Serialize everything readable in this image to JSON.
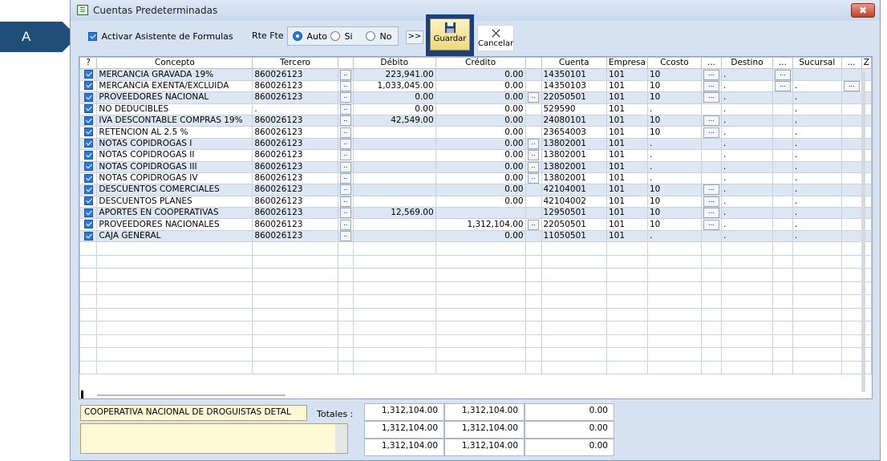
{
  "callout": {
    "label": "A"
  },
  "window": {
    "title": "Cuentas Predeterminadas",
    "app_icon": "☰",
    "close_glyph": "✖"
  },
  "toolbar": {
    "asistente_label": "Activar Asistente de Formulas",
    "rtefte_label": "Rte Fte",
    "radios": [
      {
        "label": "Auto",
        "selected": true
      },
      {
        "label": "Si",
        "selected": false
      },
      {
        "label": "No",
        "selected": false
      }
    ],
    "more_label": ">>",
    "save_label": "Guardar",
    "cancel_label": "Cancelar"
  },
  "grid": {
    "columns": [
      "?",
      "Concepto",
      "Tercero",
      "",
      "Débito",
      "Crédito",
      "",
      "Cuenta",
      "Empresa",
      "Ccosto",
      "...",
      "Destino",
      "...",
      "Sucursal",
      "...",
      "Z"
    ],
    "rows": [
      {
        "concepto": "MERCANCIA GRAVADA 19%",
        "tercero": "860026123",
        "debito": "223,941.00",
        "credito": "0.00",
        "cuenta": "14350101",
        "empresa": "101",
        "ccosto": "10",
        "cc_btn": true,
        "destino": ".",
        "dest_btn": true,
        "sucursal": "",
        "suc_btn": false,
        "cr_btn": false
      },
      {
        "concepto": "MERCANCIA EXENTA/EXCLUIDA",
        "tercero": "860026123",
        "debito": "1,033,045.00",
        "credito": "0.00",
        "cuenta": "14350103",
        "empresa": "101",
        "ccosto": "10",
        "cc_btn": true,
        "destino": ".",
        "dest_btn": true,
        "sucursal": ".",
        "suc_btn": true,
        "cr_btn": false
      },
      {
        "concepto": "PROVEEDORES NACIONAL",
        "tercero": "860026123",
        "debito": "0.00",
        "credito": "0.00",
        "cuenta": "22050501",
        "empresa": "101",
        "ccosto": "10",
        "cc_btn": true,
        "destino": ".",
        "dest_btn": false,
        "sucursal": ".",
        "suc_btn": false,
        "cr_btn": true
      },
      {
        "concepto": "NO DEDUCIBLES",
        "tercero": ".",
        "debito": "0.00",
        "credito": "0.00",
        "cuenta": "529590",
        "empresa": "101",
        "ccosto": ".",
        "cc_btn": false,
        "destino": ".",
        "dest_btn": false,
        "sucursal": ".",
        "suc_btn": false,
        "cr_btn": false
      },
      {
        "concepto": "IVA DESCONTABLE COMPRAS 19%",
        "tercero": "860026123",
        "debito": "42,549.00",
        "credito": "0.00",
        "cuenta": "24080101",
        "empresa": "101",
        "ccosto": "10",
        "cc_btn": true,
        "destino": ".",
        "dest_btn": false,
        "sucursal": ".",
        "suc_btn": false,
        "cr_btn": false
      },
      {
        "concepto": "RETENCION AL  2.5 %",
        "tercero": "860026123",
        "debito": "",
        "credito": "0.00",
        "cuenta": "23654003",
        "empresa": "101",
        "ccosto": "10",
        "cc_btn": true,
        "destino": ".",
        "dest_btn": false,
        "sucursal": ".",
        "suc_btn": false,
        "cr_btn": false
      },
      {
        "concepto": "NOTAS COPIDROGAS I",
        "tercero": "860026123",
        "debito": "",
        "credito": "0.00",
        "cuenta": "13802001",
        "empresa": "101",
        "ccosto": ".",
        "cc_btn": false,
        "destino": ".",
        "dest_btn": false,
        "sucursal": ".",
        "suc_btn": false,
        "cr_btn": true
      },
      {
        "concepto": "NOTAS COPIDROGAS II",
        "tercero": "860026123",
        "debito": "",
        "credito": "0.00",
        "cuenta": "13802001",
        "empresa": "101",
        "ccosto": ".",
        "cc_btn": false,
        "destino": ".",
        "dest_btn": false,
        "sucursal": ".",
        "suc_btn": false,
        "cr_btn": true
      },
      {
        "concepto": "NOTAS COPIDROGAS III",
        "tercero": "860026123",
        "debito": "",
        "credito": "0.00",
        "cuenta": "13802001",
        "empresa": "101",
        "ccosto": ".",
        "cc_btn": false,
        "destino": ".",
        "dest_btn": false,
        "sucursal": ".",
        "suc_btn": false,
        "cr_btn": true
      },
      {
        "concepto": "NOTAS COPIDROGAS IV",
        "tercero": "860026123",
        "debito": "",
        "credito": "0.00",
        "cuenta": "13802001",
        "empresa": "101",
        "ccosto": ".",
        "cc_btn": false,
        "destino": ".",
        "dest_btn": false,
        "sucursal": ".",
        "suc_btn": false,
        "cr_btn": true
      },
      {
        "concepto": "DESCUENTOS COMERCIALES",
        "tercero": "860026123",
        "debito": "",
        "credito": "0.00",
        "cuenta": "42104001",
        "empresa": "101",
        "ccosto": "10",
        "cc_btn": true,
        "destino": ".",
        "dest_btn": false,
        "sucursal": ".",
        "suc_btn": false,
        "cr_btn": false
      },
      {
        "concepto": "DESCUENTOS PLANES",
        "tercero": "860026123",
        "debito": "",
        "credito": "0.00",
        "cuenta": "42104002",
        "empresa": "101",
        "ccosto": "10",
        "cc_btn": true,
        "destino": ".",
        "dest_btn": false,
        "sucursal": ".",
        "suc_btn": false,
        "cr_btn": false
      },
      {
        "concepto": "APORTES EN COOPERATIVAS",
        "tercero": "860026123",
        "debito": "12,569.00",
        "credito": "",
        "cuenta": "12950501",
        "empresa": "101",
        "ccosto": "10",
        "cc_btn": true,
        "destino": ".",
        "dest_btn": false,
        "sucursal": ".",
        "suc_btn": false,
        "cr_btn": false
      },
      {
        "concepto": "PROVEEDORES NACIONALES",
        "tercero": "860026123",
        "debito": "",
        "credito": "1,312,104.00",
        "cuenta": "22050501",
        "empresa": "101",
        "ccosto": "10",
        "cc_btn": true,
        "destino": ".",
        "dest_btn": false,
        "sucursal": ".",
        "suc_btn": false,
        "cr_btn": true
      },
      {
        "concepto": "CAJA GENERAL",
        "tercero": "860026123",
        "debito": "",
        "credito": "0.00",
        "cuenta": "11050501",
        "empresa": "101",
        "ccosto": ".",
        "cc_btn": false,
        "destino": ".",
        "dest_btn": false,
        "sucursal": ".",
        "suc_btn": false,
        "cr_btn": false
      }
    ],
    "empty_rows": 10
  },
  "footer": {
    "name_value": "COOPERATIVA NACIONAL DE DROGUISTAS DETAL",
    "totales_label": "Totales :",
    "totals": [
      [
        "1,312,104.00",
        "1,312,104.00",
        "0.00"
      ],
      [
        "1,312,104.00",
        "1,312,104.00",
        "0.00"
      ],
      [
        "1,312,104.00",
        "1,312,104.00",
        "0.00"
      ]
    ]
  }
}
